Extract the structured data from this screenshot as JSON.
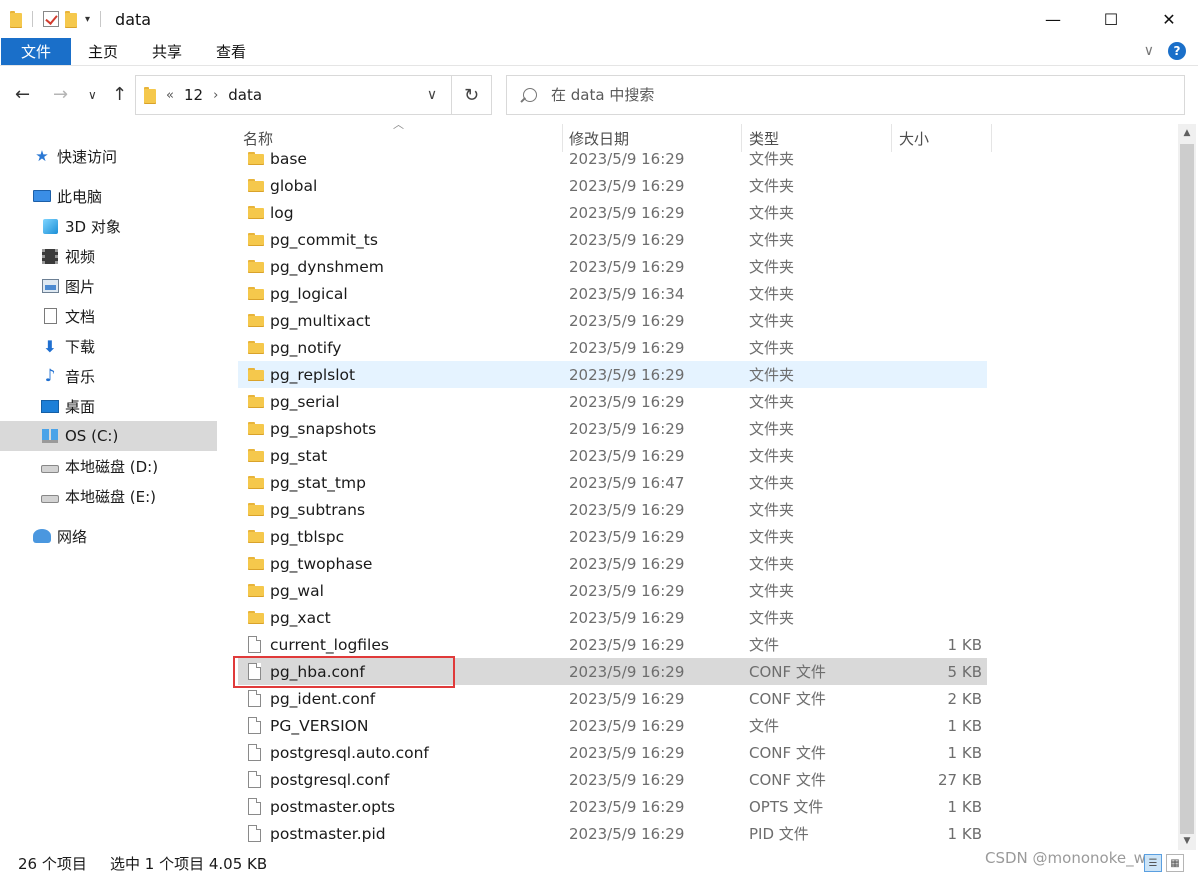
{
  "window": {
    "title": "data",
    "minimize": "—",
    "maximize": "☐",
    "close": "✕"
  },
  "ribbon": {
    "tabs": [
      "文件",
      "主页",
      "共享",
      "查看"
    ],
    "expand_icon": "∨",
    "help_icon": "?"
  },
  "address": {
    "crumb_overflow": "«",
    "crumbs": [
      "12",
      "data"
    ],
    "back_icon": "←",
    "forward_icon": "→",
    "recent_icon": "∨",
    "up_icon": "↑",
    "dropdown_icon": "∨",
    "refresh_icon": "↻"
  },
  "search": {
    "placeholder": "在 data 中搜索"
  },
  "sidebar": {
    "items": [
      {
        "label": "快速访问",
        "icon": "star-icon"
      },
      {
        "label": "此电脑",
        "icon": "computer-icon"
      },
      {
        "label": "3D 对象",
        "icon": "3d-objects-icon"
      },
      {
        "label": "视频",
        "icon": "video-icon"
      },
      {
        "label": "图片",
        "icon": "pictures-icon"
      },
      {
        "label": "文档",
        "icon": "documents-icon"
      },
      {
        "label": "下载",
        "icon": "download-icon"
      },
      {
        "label": "音乐",
        "icon": "music-icon"
      },
      {
        "label": "桌面",
        "icon": "desktop-icon"
      },
      {
        "label": "OS (C:)",
        "icon": "os-drive-icon"
      },
      {
        "label": "本地磁盘 (D:)",
        "icon": "drive-icon"
      },
      {
        "label": "本地磁盘 (E:)",
        "icon": "drive-icon"
      },
      {
        "label": "网络",
        "icon": "network-icon"
      }
    ],
    "selected_index": 9
  },
  "columns": {
    "name": "名称",
    "modified": "修改日期",
    "type": "类型",
    "size": "大小"
  },
  "files": [
    {
      "name": "base",
      "date": "2023/5/9 16:29",
      "type": "文件夹",
      "size": "",
      "kind": "folder"
    },
    {
      "name": "global",
      "date": "2023/5/9 16:29",
      "type": "文件夹",
      "size": "",
      "kind": "folder"
    },
    {
      "name": "log",
      "date": "2023/5/9 16:29",
      "type": "文件夹",
      "size": "",
      "kind": "folder"
    },
    {
      "name": "pg_commit_ts",
      "date": "2023/5/9 16:29",
      "type": "文件夹",
      "size": "",
      "kind": "folder"
    },
    {
      "name": "pg_dynshmem",
      "date": "2023/5/9 16:29",
      "type": "文件夹",
      "size": "",
      "kind": "folder"
    },
    {
      "name": "pg_logical",
      "date": "2023/5/9 16:34",
      "type": "文件夹",
      "size": "",
      "kind": "folder"
    },
    {
      "name": "pg_multixact",
      "date": "2023/5/9 16:29",
      "type": "文件夹",
      "size": "",
      "kind": "folder"
    },
    {
      "name": "pg_notify",
      "date": "2023/5/9 16:29",
      "type": "文件夹",
      "size": "",
      "kind": "folder"
    },
    {
      "name": "pg_replslot",
      "date": "2023/5/9 16:29",
      "type": "文件夹",
      "size": "",
      "kind": "folder"
    },
    {
      "name": "pg_serial",
      "date": "2023/5/9 16:29",
      "type": "文件夹",
      "size": "",
      "kind": "folder"
    },
    {
      "name": "pg_snapshots",
      "date": "2023/5/9 16:29",
      "type": "文件夹",
      "size": "",
      "kind": "folder"
    },
    {
      "name": "pg_stat",
      "date": "2023/5/9 16:29",
      "type": "文件夹",
      "size": "",
      "kind": "folder"
    },
    {
      "name": "pg_stat_tmp",
      "date": "2023/5/9 16:47",
      "type": "文件夹",
      "size": "",
      "kind": "folder"
    },
    {
      "name": "pg_subtrans",
      "date": "2023/5/9 16:29",
      "type": "文件夹",
      "size": "",
      "kind": "folder"
    },
    {
      "name": "pg_tblspc",
      "date": "2023/5/9 16:29",
      "type": "文件夹",
      "size": "",
      "kind": "folder"
    },
    {
      "name": "pg_twophase",
      "date": "2023/5/9 16:29",
      "type": "文件夹",
      "size": "",
      "kind": "folder"
    },
    {
      "name": "pg_wal",
      "date": "2023/5/9 16:29",
      "type": "文件夹",
      "size": "",
      "kind": "folder"
    },
    {
      "name": "pg_xact",
      "date": "2023/5/9 16:29",
      "type": "文件夹",
      "size": "",
      "kind": "folder"
    },
    {
      "name": "current_logfiles",
      "date": "2023/5/9 16:29",
      "type": "文件",
      "size": "1 KB",
      "kind": "file"
    },
    {
      "name": "pg_hba.conf",
      "date": "2023/5/9 16:29",
      "type": "CONF 文件",
      "size": "5 KB",
      "kind": "file"
    },
    {
      "name": "pg_ident.conf",
      "date": "2023/5/9 16:29",
      "type": "CONF 文件",
      "size": "2 KB",
      "kind": "file"
    },
    {
      "name": "PG_VERSION",
      "date": "2023/5/9 16:29",
      "type": "文件",
      "size": "1 KB",
      "kind": "file"
    },
    {
      "name": "postgresql.auto.conf",
      "date": "2023/5/9 16:29",
      "type": "CONF 文件",
      "size": "1 KB",
      "kind": "file"
    },
    {
      "name": "postgresql.conf",
      "date": "2023/5/9 16:29",
      "type": "CONF 文件",
      "size": "27 KB",
      "kind": "file"
    },
    {
      "name": "postmaster.opts",
      "date": "2023/5/9 16:29",
      "type": "OPTS 文件",
      "size": "1 KB",
      "kind": "file"
    },
    {
      "name": "postmaster.pid",
      "date": "2023/5/9 16:29",
      "type": "PID 文件",
      "size": "1 KB",
      "kind": "file"
    }
  ],
  "hover_index": 8,
  "selected_index": 19,
  "status": {
    "count": "26 个项目",
    "selection": "选中 1 个项目  4.05 KB"
  },
  "watermark": "CSDN @mononoke_wz",
  "colors": {
    "accent": "#1a6fc9",
    "highlight_box": "#e03a3a",
    "hover_row": "#e5f3ff",
    "selected_row": "#d9d9d9"
  }
}
